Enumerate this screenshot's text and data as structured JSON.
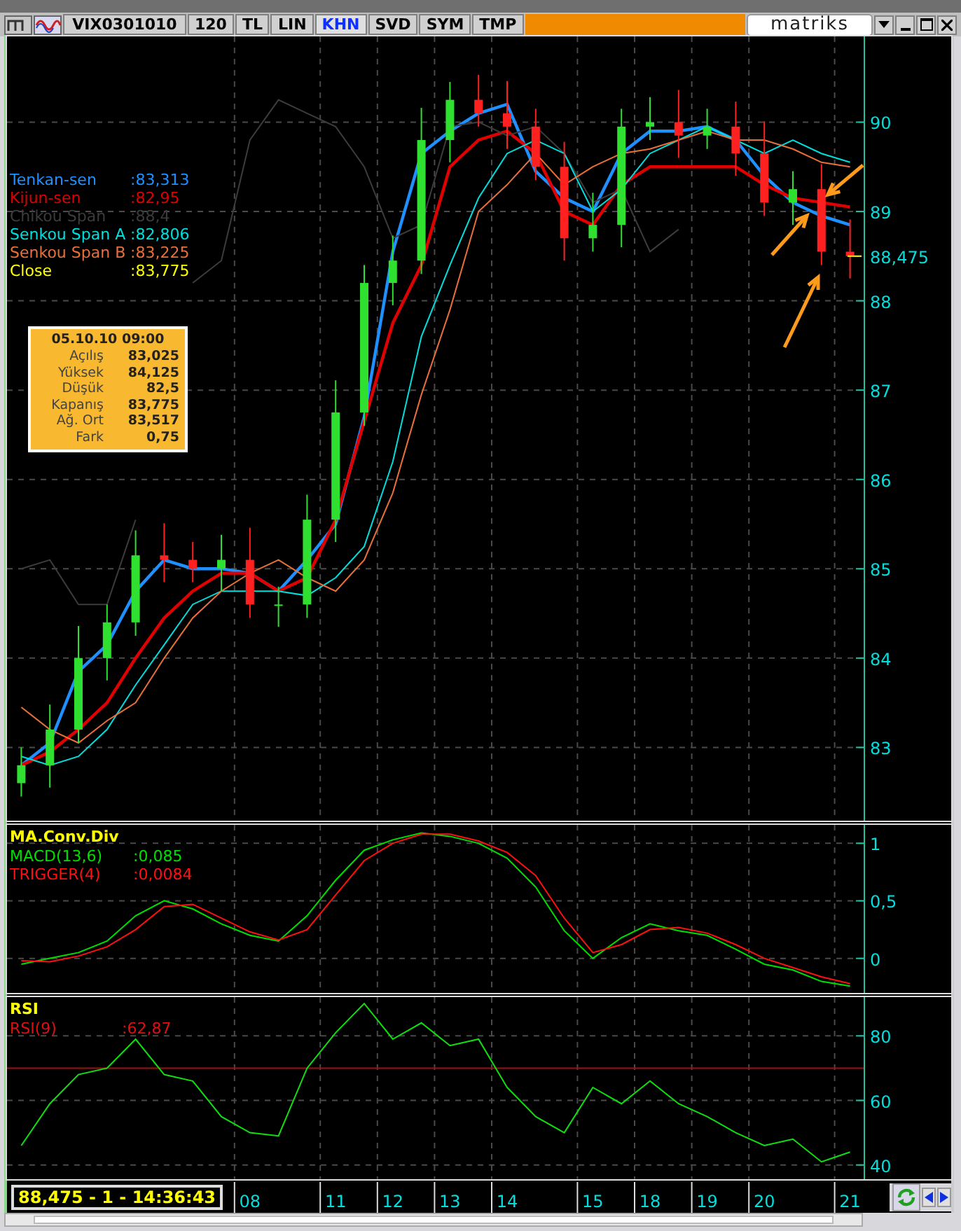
{
  "toolbar": {
    "symbol": "VIX0301010",
    "buttons": [
      {
        "label": "120",
        "selected": false
      },
      {
        "label": "TL",
        "selected": false
      },
      {
        "label": "LIN",
        "selected": false
      },
      {
        "label": "KHN",
        "selected": true
      },
      {
        "label": "SVD",
        "selected": false
      },
      {
        "label": "SYM",
        "selected": false
      },
      {
        "label": "TMP",
        "selected": false
      }
    ],
    "logo": "matriks"
  },
  "price_panel": {
    "legend": [
      {
        "value": ":83,313"
      },
      {
        "value": ":82,95"
      },
      {
        "value": ":88,4"
      },
      {
        "value": ":82,806"
      },
      {
        "value": ":83,225"
      },
      {
        "label": "Close",
        "value": ":83,775",
        "color": "#ffff00"
      }
    ],
    "last_price": "88,475",
    "tooltip": {
      "date": "05.10.10 09:00",
      "rows": [
        {
          "label": "Açılış",
          "value": "83,025"
        },
        {
          "label": "Yüksek",
          "value": "84,125"
        },
        {
          "label": "Düşük",
          "value": "82,5"
        },
        {
          "label": "Kapanış",
          "value": "83,775"
        },
        {
          "label": "Ağ. Ort",
          "value": "83,517"
        },
        {
          "label": "Fark",
          "value": "0,75"
        }
      ]
    },
    "chart_data": {
      "type": "candlestick",
      "grid": true,
      "ylim": [
        82.18,
        90.96
      ],
      "yticks": [
        {
          "value": 83,
          "label": "83"
        },
        {
          "value": 84,
          "label": "84"
        },
        {
          "value": 85,
          "label": "85"
        },
        {
          "value": 86,
          "label": "86"
        },
        {
          "value": 87,
          "label": "87"
        },
        {
          "value": 88,
          "label": "88"
        },
        {
          "value": 89,
          "label": "89"
        },
        {
          "value": 90,
          "label": "90"
        }
      ],
      "categories": [
        null,
        null,
        null,
        null,
        null,
        null,
        null,
        null,
        null,
        null,
        null,
        null,
        null,
        null,
        null,
        null,
        null,
        null,
        null,
        null,
        null,
        null,
        null,
        null,
        null,
        null,
        null,
        null,
        null,
        null
      ],
      "ohlc": [
        [
          82.6,
          83.0,
          82.45,
          82.8
        ],
        [
          82.8,
          83.48,
          82.55,
          83.2
        ],
        [
          83.2,
          84.36,
          83.05,
          84.0
        ],
        [
          84.0,
          84.6,
          83.75,
          84.4
        ],
        [
          84.4,
          85.43,
          84.25,
          85.15
        ],
        [
          85.15,
          85.51,
          84.85,
          85.1
        ],
        [
          85.1,
          85.3,
          84.85,
          85.0
        ],
        [
          85.0,
          85.38,
          84.75,
          85.1
        ],
        [
          85.1,
          85.46,
          84.45,
          84.6
        ],
        [
          84.6,
          84.8,
          84.35,
          84.6
        ],
        [
          84.6,
          85.83,
          84.45,
          85.55
        ],
        [
          85.55,
          87.11,
          85.3,
          86.75
        ],
        [
          86.75,
          88.4,
          86.6,
          88.2
        ],
        [
          88.2,
          88.73,
          87.95,
          88.45
        ],
        [
          88.45,
          90.16,
          88.3,
          89.8
        ],
        [
          89.8,
          90.45,
          89.55,
          90.25
        ],
        [
          90.25,
          90.53,
          89.95,
          90.1
        ],
        [
          90.1,
          90.46,
          89.7,
          89.95
        ],
        [
          89.95,
          90.15,
          89.35,
          89.5
        ],
        [
          89.5,
          89.78,
          88.45,
          88.7
        ],
        [
          88.7,
          89.21,
          88.55,
          88.85
        ],
        [
          88.85,
          90.15,
          88.6,
          89.95
        ],
        [
          89.95,
          90.28,
          89.8,
          90.0
        ],
        [
          90.0,
          90.36,
          89.6,
          89.85
        ],
        [
          89.85,
          90.15,
          89.7,
          89.95
        ],
        [
          89.95,
          90.23,
          89.4,
          89.65
        ],
        [
          89.65,
          90.01,
          88.95,
          89.1
        ],
        [
          89.1,
          89.45,
          88.85,
          89.25
        ],
        [
          89.25,
          89.53,
          88.4,
          88.55
        ],
        [
          88.55,
          88.91,
          88.25,
          88.5
        ]
      ],
      "series": [
        {
          "name": "Tenkan-sen",
          "type": "line",
          "color": "#1e90ff",
          "values": [
            82.8,
            83.05,
            83.85,
            84.15,
            84.75,
            85.1,
            85.0,
            85.0,
            84.95,
            84.75,
            85.1,
            85.5,
            86.7,
            88.55,
            89.65,
            89.9,
            90.1,
            90.2,
            89.45,
            89.15,
            89.0,
            89.65,
            89.9,
            89.9,
            89.95,
            89.8,
            89.4,
            89.1,
            88.95,
            88.85
          ]
        },
        {
          "name": "Kijun-sen",
          "type": "line",
          "color": "#e00000",
          "values": [
            82.8,
            82.95,
            83.2,
            83.5,
            84.0,
            84.45,
            84.75,
            84.95,
            84.95,
            84.75,
            84.9,
            85.55,
            86.65,
            87.75,
            88.4,
            89.5,
            89.8,
            89.9,
            89.65,
            89.0,
            88.85,
            89.3,
            89.5,
            89.5,
            89.5,
            89.5,
            89.3,
            89.15,
            89.1,
            89.05
          ]
        },
        {
          "name": "Chikou Span",
          "type": "line",
          "color": "#3c3c3c",
          "values": [
            85.0,
            85.1,
            84.6,
            84.6,
            85.55,
            null,
            88.2,
            88.45,
            89.8,
            90.25,
            90.1,
            89.95,
            89.5,
            88.7,
            88.85,
            89.95,
            90.0,
            89.85,
            89.95,
            89.65,
            89.1,
            89.25,
            88.55,
            88.8,
            null,
            null,
            null,
            null,
            null,
            null
          ]
        },
        {
          "name": "Senkou Span A",
          "type": "line",
          "color": "#00dede",
          "values": [
            82.9,
            82.8,
            82.9,
            83.2,
            83.7,
            84.15,
            84.6,
            84.75,
            84.75,
            84.75,
            84.7,
            84.9,
            85.25,
            86.2,
            87.6,
            88.4,
            89.15,
            89.65,
            89.8,
            89.65,
            89.0,
            89.25,
            89.65,
            89.8,
            89.95,
            89.8,
            89.65,
            89.8,
            89.65,
            89.55
          ]
        },
        {
          "name": "Senkou Span B",
          "type": "line",
          "color": "#e8703c",
          "values": [
            83.45,
            83.2,
            83.05,
            83.3,
            83.5,
            84.0,
            84.45,
            84.75,
            84.95,
            85.1,
            84.9,
            84.75,
            85.1,
            85.85,
            86.95,
            87.9,
            89.0,
            89.3,
            89.65,
            89.3,
            89.5,
            89.65,
            89.7,
            89.8,
            89.9,
            89.8,
            89.8,
            89.7,
            89.55,
            89.5
          ]
        }
      ]
    }
  },
  "macd_panel": {
    "title": "MA.Conv.Div",
    "legend": [
      {
        "value": ":0,085"
      },
      {
        "value": ":0,0084"
      }
    ],
    "chart_data": {
      "type": "line",
      "grid": true,
      "ylim": [
        -0.3,
        1.16
      ],
      "yticks": [
        {
          "value": 0,
          "label": "0"
        },
        {
          "value": 0.5,
          "label": "0,5"
        },
        {
          "value": 1,
          "label": "1"
        }
      ],
      "categories": [
        null,
        null,
        null,
        null,
        null,
        null,
        null,
        null,
        null,
        null,
        null,
        null,
        null,
        null,
        null,
        null,
        null,
        null,
        null,
        null,
        null,
        null,
        null,
        null,
        null,
        null,
        null,
        null,
        null,
        null
      ],
      "series": [
        {
          "name": "MACD(13,6)",
          "color": "#00e000",
          "values": [
            -0.05,
            0,
            0.05,
            0.15,
            0.37,
            0.5,
            0.43,
            0.3,
            0.2,
            0.15,
            0.37,
            0.68,
            0.94,
            1.03,
            1.09,
            1.06,
            1.0,
            0.87,
            0.62,
            0.24,
            0,
            0.18,
            0.3,
            0.24,
            0.2,
            0.08,
            -0.05,
            -0.1,
            -0.2,
            -0.24
          ]
        },
        {
          "name": "TRIGGER(4)",
          "color": "#ff1010",
          "values": [
            -0.02,
            -0.03,
            0.02,
            0.1,
            0.25,
            0.45,
            0.47,
            0.35,
            0.23,
            0.16,
            0.25,
            0.55,
            0.85,
            1.0,
            1.08,
            1.08,
            1.02,
            0.92,
            0.72,
            0.35,
            0.05,
            0.12,
            0.25,
            0.27,
            0.22,
            0.12,
            0.0,
            -0.08,
            -0.16,
            -0.22
          ]
        }
      ]
    }
  },
  "rsi_panel": {
    "title": "RSI",
    "legend": [
      {
        "value": ":62,87"
      }
    ],
    "chart_data": {
      "type": "line",
      "grid": true,
      "ylim": [
        35.6,
        92
      ],
      "yticks": [
        {
          "value": 40,
          "label": "40"
        },
        {
          "value": 60,
          "label": "60"
        },
        {
          "value": 80,
          "label": "80"
        }
      ],
      "categories": [
        null,
        null,
        null,
        null,
        null,
        null,
        null,
        null,
        "08",
        null,
        null,
        "11",
        null,
        "12",
        null,
        "13",
        null,
        "14",
        null,
        null,
        "15",
        null,
        "18",
        null,
        "19",
        null,
        "20",
        null,
        null,
        "21"
      ],
      "ref_lines": [
        {
          "axis": "y",
          "value": 70
        }
      ],
      "series": [
        {
          "name": "RSI(9)",
          "color": "#10e010",
          "values": [
            46,
            59,
            68,
            70,
            79,
            68,
            66,
            55,
            50,
            49,
            70,
            81,
            90,
            79,
            84,
            77,
            79,
            64,
            55,
            50,
            64,
            59,
            66,
            59,
            55,
            50,
            46,
            48,
            41,
            44
          ]
        }
      ]
    }
  },
  "status": "88,475 - 1 - 14:36:43"
}
